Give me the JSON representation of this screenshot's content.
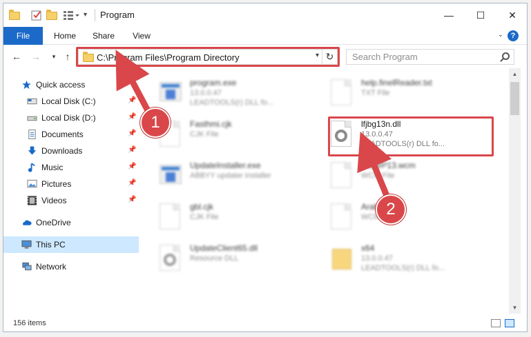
{
  "window": {
    "title": "Program",
    "controls": {
      "minimize": "—",
      "maximize": "☐",
      "close": "✕"
    }
  },
  "ribbon": {
    "tabs": [
      "File",
      "Home",
      "Share",
      "View"
    ],
    "help": "?"
  },
  "address": {
    "path": "C:\\Program Files\\Program Directory",
    "search_placeholder": "Search Program"
  },
  "nav_pane": {
    "quick_access": "Quick access",
    "items": [
      {
        "label": "Local Disk (C:)",
        "icon": "drive-icon",
        "pinned": true
      },
      {
        "label": "Local Disk (D:)",
        "icon": "drive-icon",
        "pinned": true
      },
      {
        "label": "Documents",
        "icon": "documents-icon",
        "pinned": true
      },
      {
        "label": "Downloads",
        "icon": "downloads-icon",
        "pinned": true
      },
      {
        "label": "Music",
        "icon": "music-icon",
        "pinned": true
      },
      {
        "label": "Pictures",
        "icon": "pictures-icon",
        "pinned": true
      },
      {
        "label": "Videos",
        "icon": "videos-icon",
        "pinned": true
      }
    ],
    "onedrive": "OneDrive",
    "this_pc": "This PC",
    "network": "Network"
  },
  "files": [
    {
      "name": "program.exe",
      "line2": "13.0.0.47",
      "line3": "LEADTOOLS(r) DLL fo...",
      "icon": "exe-icon",
      "blurred": true
    },
    {
      "name": "help.finelReader.txt",
      "line2": "TXT File",
      "line3": "",
      "icon": "document-icon",
      "blurred": true
    },
    {
      "name": "Fasthmi.cjk",
      "line2": "CJK File",
      "line3": "",
      "icon": "document-icon",
      "blurred": true
    },
    {
      "name": "lfjbg13n.dll",
      "line2": "13.0.0.47",
      "line3": "LEADTOOLS(r) DLL fo...",
      "icon": "dll-gear-icon",
      "blurred": false,
      "highlighted": true
    },
    {
      "name": "UpdateInstaller.exe",
      "line2": "ABBYY updater installer",
      "line3": "",
      "icon": "exe-icon",
      "blurred": true
    },
    {
      "name": "MSWP13.wcm",
      "line2": "WCM File",
      "line3": "",
      "icon": "document-icon",
      "blurred": true
    },
    {
      "name": "gbl.cjk",
      "line2": "CJK File",
      "line3": "",
      "icon": "document-icon",
      "blurred": true
    },
    {
      "name": "Arab.wcm",
      "line2": "WCM File",
      "line3": "",
      "icon": "document-icon",
      "blurred": true
    },
    {
      "name": "UpdateClient65.dll",
      "line2": "Resource DLL",
      "line3": "",
      "icon": "dll-gear-icon",
      "blurred": true
    },
    {
      "name": "x64",
      "line2": "13.0.0.47",
      "line3": "LEADTOOLS(r) DLL fo...",
      "icon": "archive-icon",
      "blurred": true
    }
  ],
  "status": {
    "count": "156 items"
  },
  "annotations": {
    "badge1": "1",
    "badge2": "2"
  },
  "colors": {
    "accent": "#1b6ac9",
    "highlight": "#d9474a",
    "selected": "#cde8ff"
  }
}
